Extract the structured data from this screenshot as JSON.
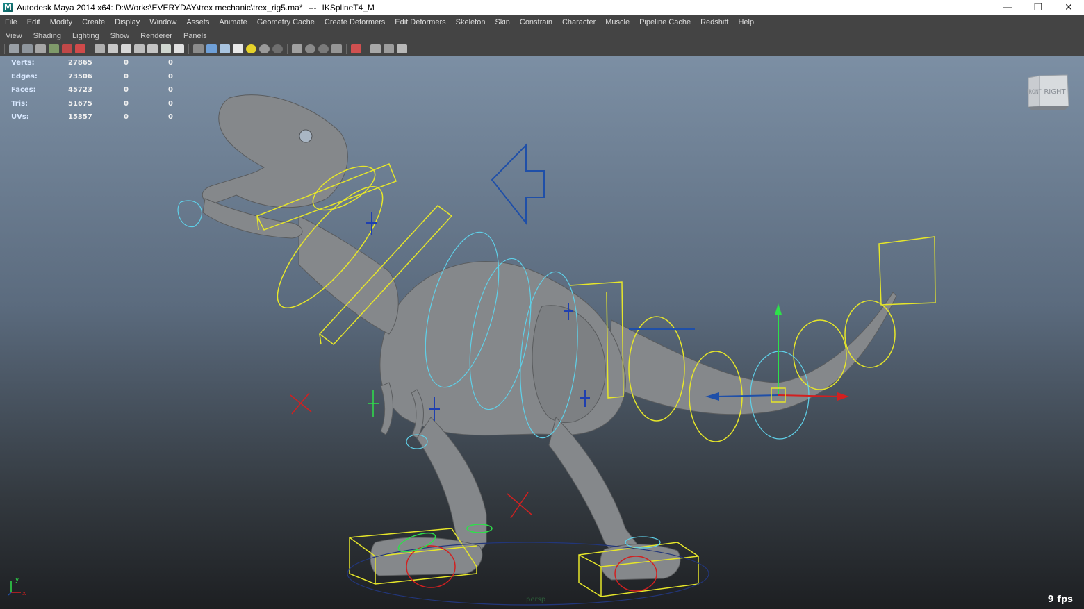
{
  "window": {
    "title": "Autodesk Maya 2014 x64: D:\\Works\\EVERYDAY\\trex mechanic\\trex_rig5.ma*",
    "separator": "---",
    "selection": "IKSplineT4_M"
  },
  "menus": [
    "File",
    "Edit",
    "Modify",
    "Create",
    "Display",
    "Window",
    "Assets",
    "Animate",
    "Geometry Cache",
    "Create Deformers",
    "Edit Deformers",
    "Skeleton",
    "Skin",
    "Constrain",
    "Character",
    "Muscle",
    "Pipeline Cache",
    "Redshift",
    "Help"
  ],
  "panel_menus": [
    "View",
    "Shading",
    "Lighting",
    "Show",
    "Renderer",
    "Panels"
  ],
  "hud": {
    "rows": [
      {
        "label": "Verts:",
        "a": "27865",
        "b": "0",
        "c": "0"
      },
      {
        "label": "Edges:",
        "a": "73506",
        "b": "0",
        "c": "0"
      },
      {
        "label": "Faces:",
        "a": "45723",
        "b": "0",
        "c": "0"
      },
      {
        "label": "Tris:",
        "a": "51675",
        "b": "0",
        "c": "0"
      },
      {
        "label": "UVs:",
        "a": "15357",
        "b": "0",
        "c": "0"
      }
    ]
  },
  "viewcube": {
    "front_label": "FRONT",
    "right_label": "RIGHT"
  },
  "camera_name": "persp",
  "fps": "9 fps",
  "axis": {
    "y": "y",
    "x": "x"
  },
  "colors": {
    "control_yellow": "#e6e62a",
    "control_cyan": "#5fd0e8",
    "control_blue": "#1f4fa8",
    "control_green": "#2ee04a",
    "control_red": "#d22020",
    "mesh": "#8a8d90"
  }
}
